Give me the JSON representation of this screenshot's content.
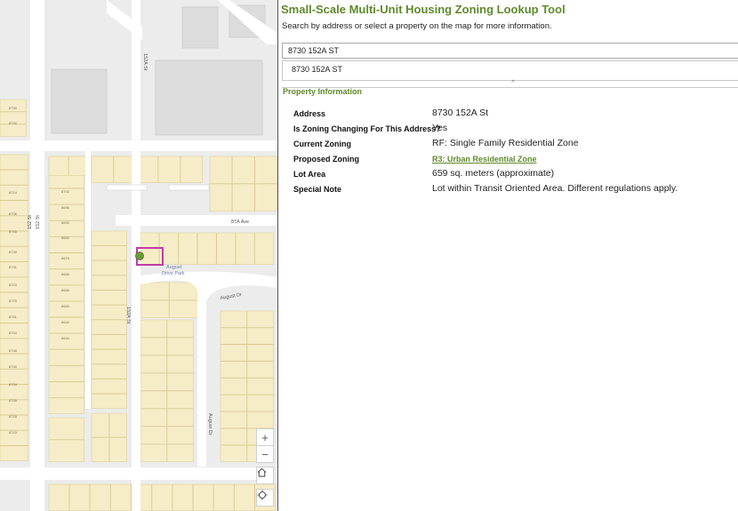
{
  "app": {
    "title": "Small-Scale Multi-Unit Housing Zoning Lookup Tool",
    "subtitle": "Search by address or select a property on the map for more information.",
    "accent_color": "#5f8a2b"
  },
  "search": {
    "value": "8730 152A ST",
    "suggestion": "8730 152A ST",
    "collapse_glyph": "^"
  },
  "property": {
    "section_title": "Property Information",
    "rows": [
      {
        "label": "Address",
        "value": "8730 152A St"
      },
      {
        "label": "Is Zoning Changing For This Address?",
        "value": "Yes"
      },
      {
        "label": "Current Zoning",
        "value": "RF: Single Family Residential Zone"
      },
      {
        "label": "Proposed Zoning",
        "value": "R3: Urban Residential Zone"
      },
      {
        "label": "Lot Area",
        "value": "659 sq. meters (approximate)"
      },
      {
        "label": "Special Note",
        "value": "Lot within Transit Oriented Area. Different regulations apply."
      }
    ]
  },
  "map": {
    "streets": [
      "152 St",
      "152 St",
      "152A St",
      "152A St",
      "87A Ave",
      "August Dr",
      "August Dr"
    ],
    "park_label": [
      "August",
      "Drive Park"
    ],
    "lot_numbers": [
      "8730",
      "8722",
      "8714",
      "8706",
      "8745",
      "8739",
      "8731",
      "8723",
      "8775",
      "8761",
      "8754",
      "8748",
      "8740",
      "8734",
      "8726",
      "8718",
      "8710",
      "8702",
      "8696",
      "8690",
      "8682",
      "8674",
      "8666",
      "8658",
      "8650",
      "8642",
      "8634",
      "8626",
      "8618"
    ],
    "controls": {
      "zoom_in": "+",
      "zoom_out": "−",
      "home_icon": "home-icon",
      "locate_icon": "locate-icon"
    },
    "colors": {
      "lot_fill": "#f6ecc7",
      "road": "#ffffff",
      "background": "#ececec",
      "selection": "#c33aa8",
      "marker": "#6b9a36"
    }
  }
}
